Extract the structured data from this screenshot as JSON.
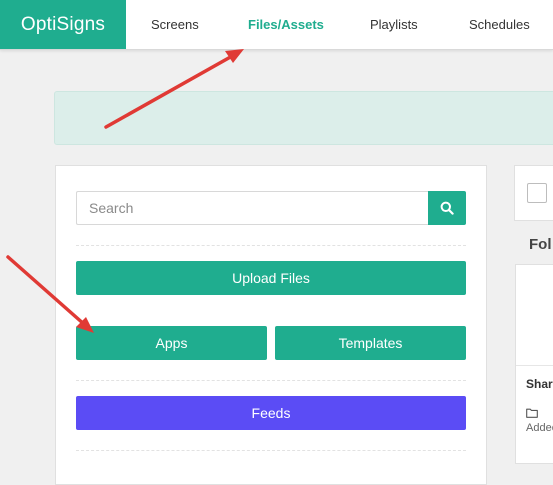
{
  "brand": {
    "name": "OptiSigns"
  },
  "nav": {
    "items": [
      {
        "label": "Screens",
        "active": false
      },
      {
        "label": "Files/Assets",
        "active": true
      },
      {
        "label": "Playlists",
        "active": false
      },
      {
        "label": "Schedules",
        "active": false
      }
    ]
  },
  "search": {
    "placeholder": "Search",
    "value": "",
    "icon": "search-icon"
  },
  "actions": {
    "upload_label": "Upload Files",
    "apps_label": "Apps",
    "templates_label": "Templates",
    "feeds_label": "Feeds"
  },
  "folders": {
    "heading": "Fol",
    "card": {
      "name": "Shar",
      "meta": "Addec",
      "icon": "folder-icon"
    }
  },
  "annotations": {
    "arrow_color": "#e03a35"
  },
  "colors": {
    "accent": "#1fad8f",
    "feeds": "#5b4cf5",
    "banner": "#dceeea"
  }
}
